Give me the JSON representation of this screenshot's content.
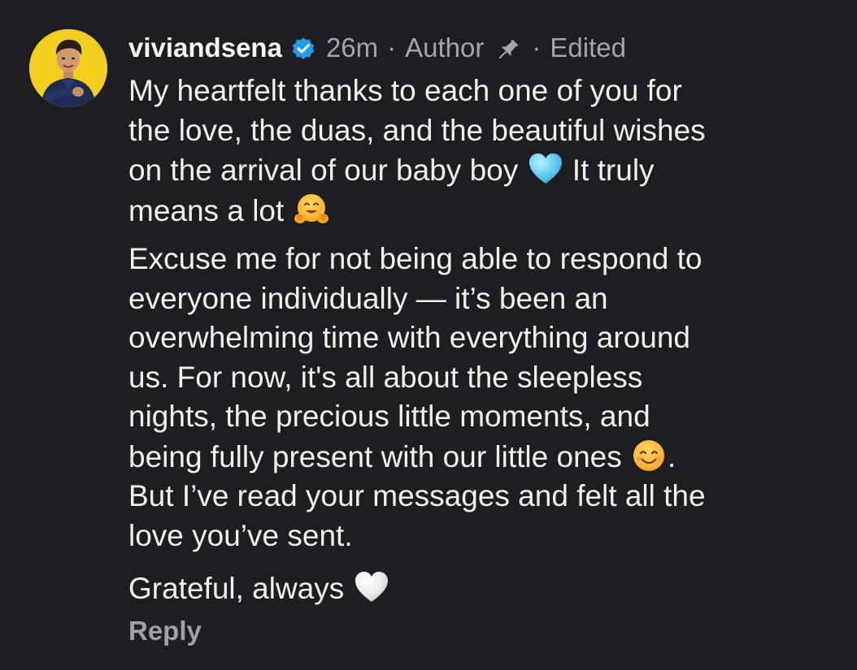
{
  "comment": {
    "username": "viviandsena",
    "time": "26m",
    "separator": "·",
    "author_label": "Author",
    "edited_label": "Edited",
    "paragraphs": {
      "p1": {
        "l1": "My heartfelt thanks to each one of you for",
        "l2": "the love, the duas, and the beautiful wishes",
        "l3a": "on the arrival of our baby boy",
        "l3b": "It truly",
        "l4": "means a lot"
      },
      "p2": {
        "l1": "Excuse me for not being able to respond to",
        "l2": "everyone individually — it’s been an",
        "l3": "overwhelming time with everything around",
        "l4": "us. For now, it's all about the sleepless",
        "l5": "nights, the precious little moments, and",
        "l6a": "being fully present with our little ones",
        "l6b": ".",
        "l7": "But I’ve read your messages and felt all the",
        "l8": "love you’ve sent."
      },
      "p3": {
        "l1": "Grateful, always"
      }
    },
    "reply_label": "Reply"
  },
  "icons": {
    "verified": "verified-badge-icon",
    "pin": "pin-icon",
    "emoji_blue_heart": "light-blue-heart-emoji",
    "emoji_hug": "hugging-face-emoji",
    "emoji_smile": "smiling-face-emoji",
    "emoji_white_heart": "white-heart-emoji"
  },
  "colors": {
    "background": "#1d1e22",
    "text": "#f0f0f0",
    "muted": "#a4a6ad",
    "verified_blue": "#1d9bf0",
    "avatar_ring": "#f2cf1e"
  }
}
